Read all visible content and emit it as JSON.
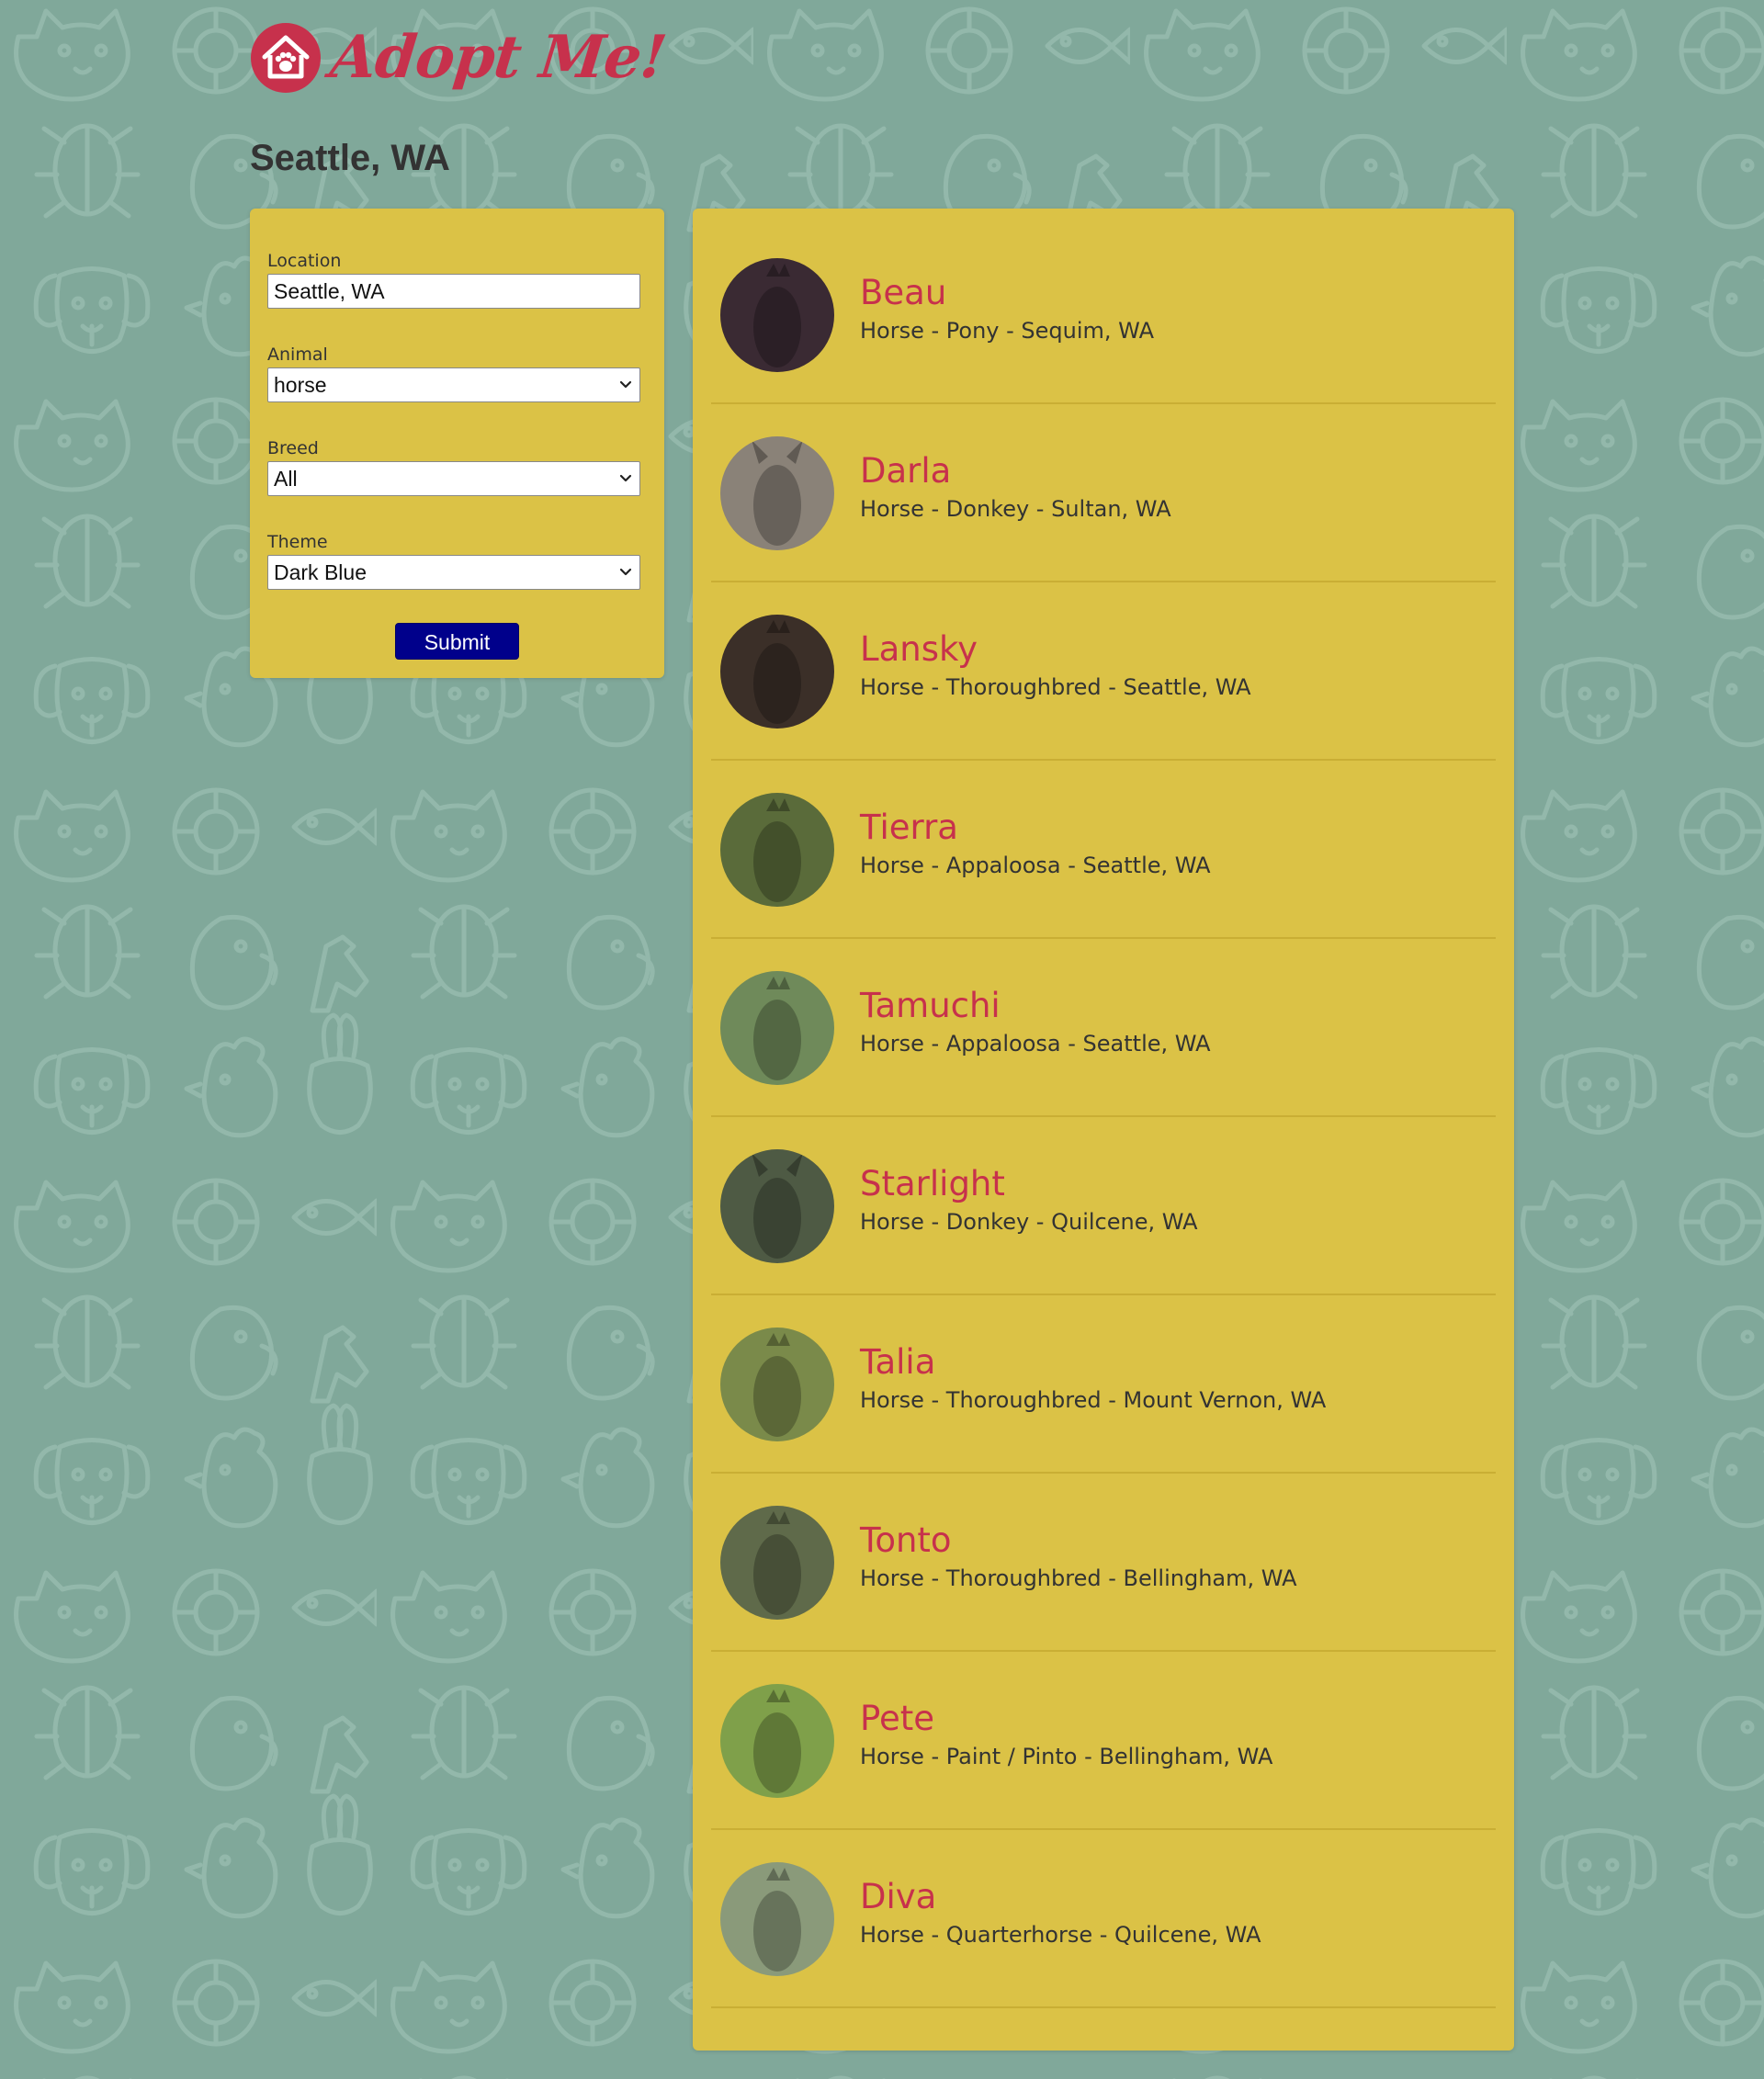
{
  "brand": {
    "logo_text": "Adopt Me!",
    "accent_color": "#c7314c",
    "background_color": "#80a89a",
    "panel_color": "#dbc246",
    "button_color": "#00008b"
  },
  "page_title": "Seattle, WA",
  "search_form": {
    "location_label": "Location",
    "location_value": "Seattle, WA",
    "animal_label": "Animal",
    "animal_value": "horse",
    "breed_label": "Breed",
    "breed_value": "All",
    "theme_label": "Theme",
    "theme_value": "Dark Blue",
    "submit_label": "Submit"
  },
  "pets": [
    {
      "name": "Beau",
      "description": "Horse - Pony - Sequim, WA",
      "photo_color": "#3a2a33"
    },
    {
      "name": "Darla",
      "description": "Horse - Donkey - Sultan, WA",
      "photo_color": "#8a8278"
    },
    {
      "name": "Lansky",
      "description": "Horse - Thoroughbred - Seattle, WA",
      "photo_color": "#3b2f28"
    },
    {
      "name": "Tierra",
      "description": "Horse - Appaloosa - Seattle, WA",
      "photo_color": "#5a6b3a"
    },
    {
      "name": "Tamuchi",
      "description": "Horse - Appaloosa - Seattle, WA",
      "photo_color": "#6f8a5a"
    },
    {
      "name": "Starlight",
      "description": "Horse - Donkey - Quilcene, WA",
      "photo_color": "#4e5a44"
    },
    {
      "name": "Talia",
      "description": "Horse - Thoroughbred - Mount Vernon, WA",
      "photo_color": "#7a8a4a"
    },
    {
      "name": "Tonto",
      "description": "Horse - Thoroughbred - Bellingham, WA",
      "photo_color": "#5f6a4a"
    },
    {
      "name": "Pete",
      "description": "Horse - Paint / Pinto - Bellingham, WA",
      "photo_color": "#7fa04a"
    },
    {
      "name": "Diva",
      "description": "Horse - Quarterhorse - Quilcene, WA",
      "photo_color": "#8a9a7a"
    }
  ]
}
